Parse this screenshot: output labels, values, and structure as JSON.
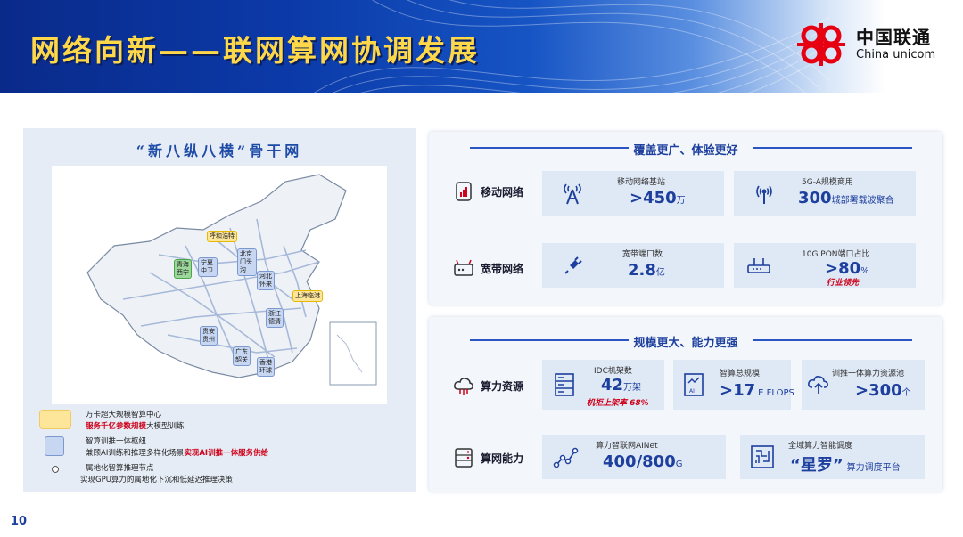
{
  "header": {
    "title": "网络向新——联网算网协调发展",
    "logo_cn": "中国联通",
    "logo_en": "China unicom",
    "brand_color": "#e60012"
  },
  "map_panel": {
    "title": "“新八纵八横”骨干网",
    "cities": [
      "呼和浩特",
      "宁夏中卫",
      "北京门头沟",
      "青海西宁",
      "河北怀来",
      "上海临港",
      "浙江德清",
      "贵安贵州",
      "广东韶关",
      "香港环球"
    ],
    "legend": {
      "item1_line1": "万卡超大规模智算中心",
      "item1_red": "服务千亿参数规模",
      "item1_tail": "大模型训练",
      "item2_line1": "智算训推一体枢纽",
      "item2_prefix": "兼顾AI训练和推理多样化场景",
      "item2_red": "实现AI训推一体服务供给",
      "item3_line1": "属地化智算推理节点",
      "item3_line2": "实现GPU算力的属地化下沉和低延迟推理决策"
    }
  },
  "section1": {
    "title": "覆盖更广、体验更好",
    "row_mobile": {
      "label": "移动网络",
      "card1": {
        "label": "移动网络基站",
        "value": ">450",
        "unit": "万"
      },
      "card2": {
        "label": "5G-A规模商用",
        "value": "300",
        "unit": "城部署载波聚合"
      }
    },
    "row_broadband": {
      "label": "宽带网络",
      "card1": {
        "label": "宽带端口数",
        "value": "2.8",
        "unit": "亿"
      },
      "card2": {
        "label": "10G PON端口占比",
        "value": ">80",
        "unit": "%",
        "note": "行业领先"
      }
    }
  },
  "section2": {
    "title": "规模更大、能力更强",
    "row_compute": {
      "label": "算力资源",
      "card1": {
        "label": "IDC机架数",
        "value": "42",
        "unit": "万架",
        "note": "机柜上架率 68%"
      },
      "card2": {
        "label": "智算总规模",
        "value": ">17",
        "unit": "E FLOPS"
      },
      "card3": {
        "label": "训推一体算力资源池",
        "value": ">300",
        "unit": "个"
      }
    },
    "row_network": {
      "label": "算网能力",
      "card1": {
        "label": "算力智联网AINet",
        "value": "400/800",
        "unit": "G"
      },
      "card2": {
        "label": "全域算力智能调度",
        "value": "“星罗”",
        "unit": "算力调度平台"
      }
    }
  },
  "page_number": "10"
}
